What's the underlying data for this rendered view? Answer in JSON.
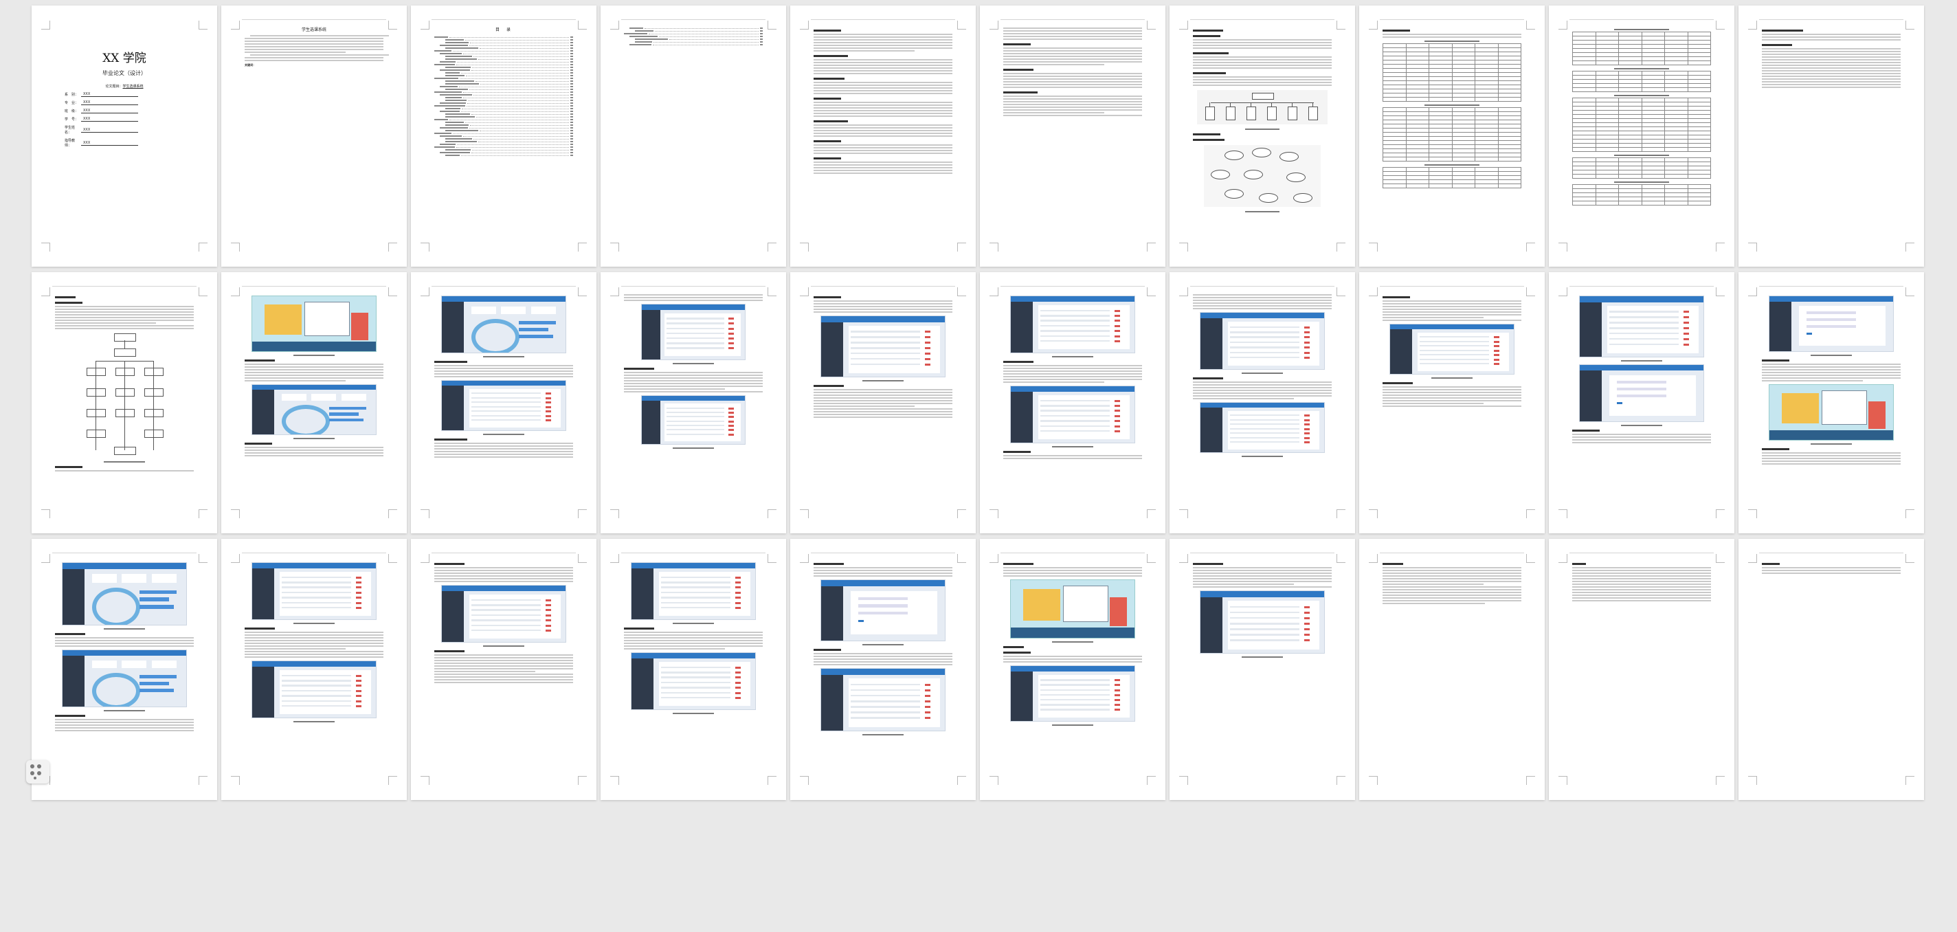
{
  "document": {
    "cover": {
      "school": "XX 学院",
      "subtitle": "毕业论文（设计）",
      "topic_label": "论文题目：",
      "topic_value": "学生选课系统",
      "fields": [
        {
          "label": "系　别：",
          "value": "XXX"
        },
        {
          "label": "专　业：",
          "value": "XXX"
        },
        {
          "label": "班　级：",
          "value": "XXX"
        },
        {
          "label": "学　号：",
          "value": "XXX"
        },
        {
          "label": "学生姓名：",
          "value": "XXX"
        },
        {
          "label": "指导教师：",
          "value": "XXX"
        }
      ]
    },
    "abstract_title": "学生选课系统",
    "keywords_label": "关键词：",
    "toc_title": "目　录"
  },
  "toolbar": {
    "fab_icon": "grid-dots-icon"
  }
}
